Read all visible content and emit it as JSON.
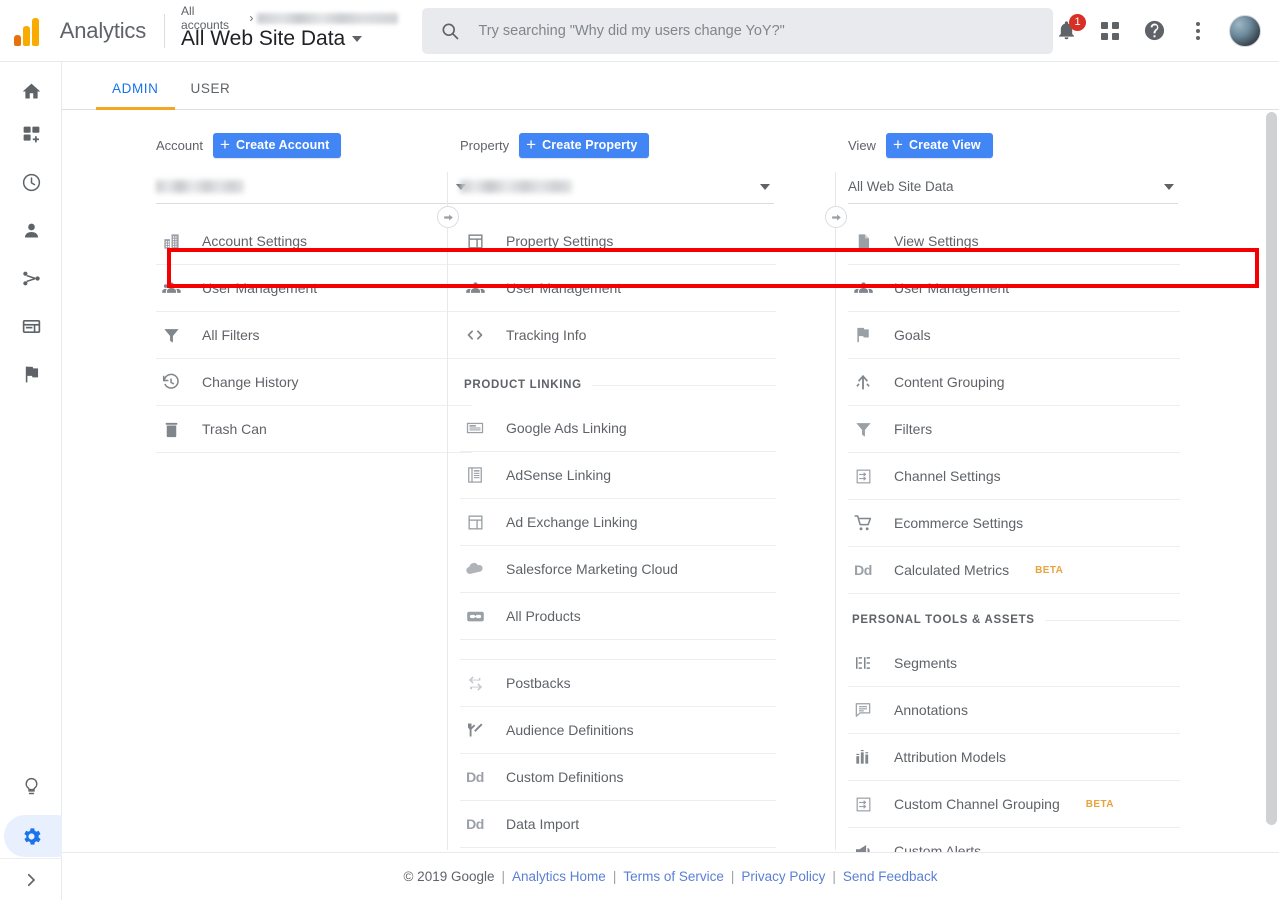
{
  "header": {
    "brand": "Analytics",
    "breadcrumb_root": "All accounts",
    "breadcrumb_sep": "›",
    "breadcrumb_account_redacted": true,
    "view_title": "All Web Site Data",
    "search_placeholder": "Try searching \"Why did my users change YoY?\"",
    "notification_count": "1",
    "icons": [
      "notifications-bell-icon",
      "apps-grid-icon",
      "help-icon",
      "more-vert-icon",
      "avatar"
    ]
  },
  "sidebar": {
    "items": [
      {
        "name": "home",
        "icon": "home-icon"
      },
      {
        "name": "customization",
        "icon": "customization-grid-plus-icon"
      },
      {
        "name": "realtime",
        "icon": "clock-icon"
      },
      {
        "name": "audience",
        "icon": "person-icon"
      },
      {
        "name": "acquisition",
        "icon": "share-nodes-icon"
      },
      {
        "name": "behavior",
        "icon": "window-layout-icon"
      },
      {
        "name": "conversions",
        "icon": "flag-icon"
      }
    ],
    "bottom": [
      {
        "name": "discover",
        "icon": "lightbulb-icon",
        "active": false
      },
      {
        "name": "admin",
        "icon": "gear-icon",
        "active": true
      },
      {
        "name": "expand",
        "icon": "chevron-right-icon",
        "active": false
      }
    ],
    "accent_active": "#1a73e8",
    "active_pill_bg": "#e8f0fe"
  },
  "tabs": [
    {
      "label": "ADMIN",
      "active": true
    },
    {
      "label": "USER",
      "active": false
    }
  ],
  "columns": [
    {
      "key": "account",
      "label": "Account",
      "create_button": "Create Account",
      "selected_value": "",
      "selected_redacted": true,
      "has_connector": true,
      "items": [
        {
          "label": "Account Settings",
          "icon": "building-icon",
          "highlighted": false
        },
        {
          "label": "User Management",
          "icon": "users-group-icon",
          "highlighted": true
        },
        {
          "label": "All Filters",
          "icon": "funnel-icon",
          "highlighted": false
        },
        {
          "label": "Change History",
          "icon": "history-clock-icon",
          "highlighted": false
        },
        {
          "label": "Trash Can",
          "icon": "trash-icon",
          "highlighted": false
        }
      ]
    },
    {
      "key": "property",
      "label": "Property",
      "create_button": "Create Property",
      "selected_value": "",
      "selected_redacted": true,
      "has_connector": true,
      "items": [
        {
          "label": "Property Settings",
          "icon": "property-window-icon",
          "highlighted": false
        },
        {
          "label": "User Management",
          "icon": "users-group-icon",
          "highlighted": true
        },
        {
          "label": "Tracking Info",
          "icon": "code-brackets-icon",
          "highlighted": false
        },
        {
          "section": "PRODUCT LINKING"
        },
        {
          "label": "Google Ads Linking",
          "icon": "google-ads-icon",
          "highlighted": false
        },
        {
          "label": "AdSense Linking",
          "icon": "adsense-icon",
          "highlighted": false
        },
        {
          "label": "Ad Exchange Linking",
          "icon": "ad-exchange-icon",
          "highlighted": false
        },
        {
          "label": "Salesforce Marketing Cloud",
          "icon": "cloud-icon",
          "highlighted": false
        },
        {
          "label": "All Products",
          "icon": "link-chain-icon",
          "highlighted": false
        },
        {
          "spacer": true
        },
        {
          "label": "Postbacks",
          "icon": "postbacks-arrows-icon",
          "highlighted": false
        },
        {
          "label": "Audience Definitions",
          "icon": "audience-branch-icon",
          "highlighted": false
        },
        {
          "label": "Custom Definitions",
          "icon": "dd-text-icon",
          "highlighted": false
        },
        {
          "label": "Data Import",
          "icon": "dd-text-icon",
          "highlighted": false
        }
      ]
    },
    {
      "key": "view",
      "label": "View",
      "create_button": "Create View",
      "selected_value": "All Web Site Data",
      "selected_redacted": false,
      "has_connector": false,
      "items": [
        {
          "label": "View Settings",
          "icon": "document-icon",
          "highlighted": false
        },
        {
          "label": "User Management",
          "icon": "users-group-icon",
          "highlighted": true
        },
        {
          "label": "Goals",
          "icon": "flag-icon",
          "highlighted": false
        },
        {
          "label": "Content Grouping",
          "icon": "content-grouping-icon",
          "highlighted": false
        },
        {
          "label": "Filters",
          "icon": "funnel-icon",
          "highlighted": false
        },
        {
          "label": "Channel Settings",
          "icon": "channel-settings-icon",
          "highlighted": false
        },
        {
          "label": "Ecommerce Settings",
          "icon": "cart-icon",
          "highlighted": false
        },
        {
          "label": "Calculated Metrics",
          "icon": "dd-text-icon",
          "badge": "BETA",
          "highlighted": false
        },
        {
          "section": "PERSONAL TOOLS & ASSETS"
        },
        {
          "label": "Segments",
          "icon": "segments-icon",
          "highlighted": false
        },
        {
          "label": "Annotations",
          "icon": "annotation-bubble-icon",
          "highlighted": false
        },
        {
          "label": "Attribution Models",
          "icon": "bar-chart-icon",
          "highlighted": false
        },
        {
          "label": "Custom Channel Grouping",
          "icon": "channel-settings-icon",
          "badge": "BETA",
          "highlighted": false
        },
        {
          "label": "Custom Alerts",
          "icon": "megaphone-icon",
          "highlighted": false
        }
      ]
    }
  ],
  "highlight": {
    "color": "#f40000",
    "target": "User Management"
  },
  "footer": {
    "copyright": "© 2019 Google",
    "links": [
      "Analytics Home",
      "Terms of Service",
      "Privacy Policy",
      "Send Feedback"
    ],
    "separator": "|"
  },
  "colors": {
    "accent_blue": "#1a73e8",
    "button_blue": "#4285f4",
    "tab_underline": "#f5a623",
    "beta_orange": "#e8a33d",
    "text_primary": "#202124",
    "text_secondary": "#5f6368",
    "icon_gray": "#9aa0a6",
    "highlight_red": "#f40000"
  }
}
